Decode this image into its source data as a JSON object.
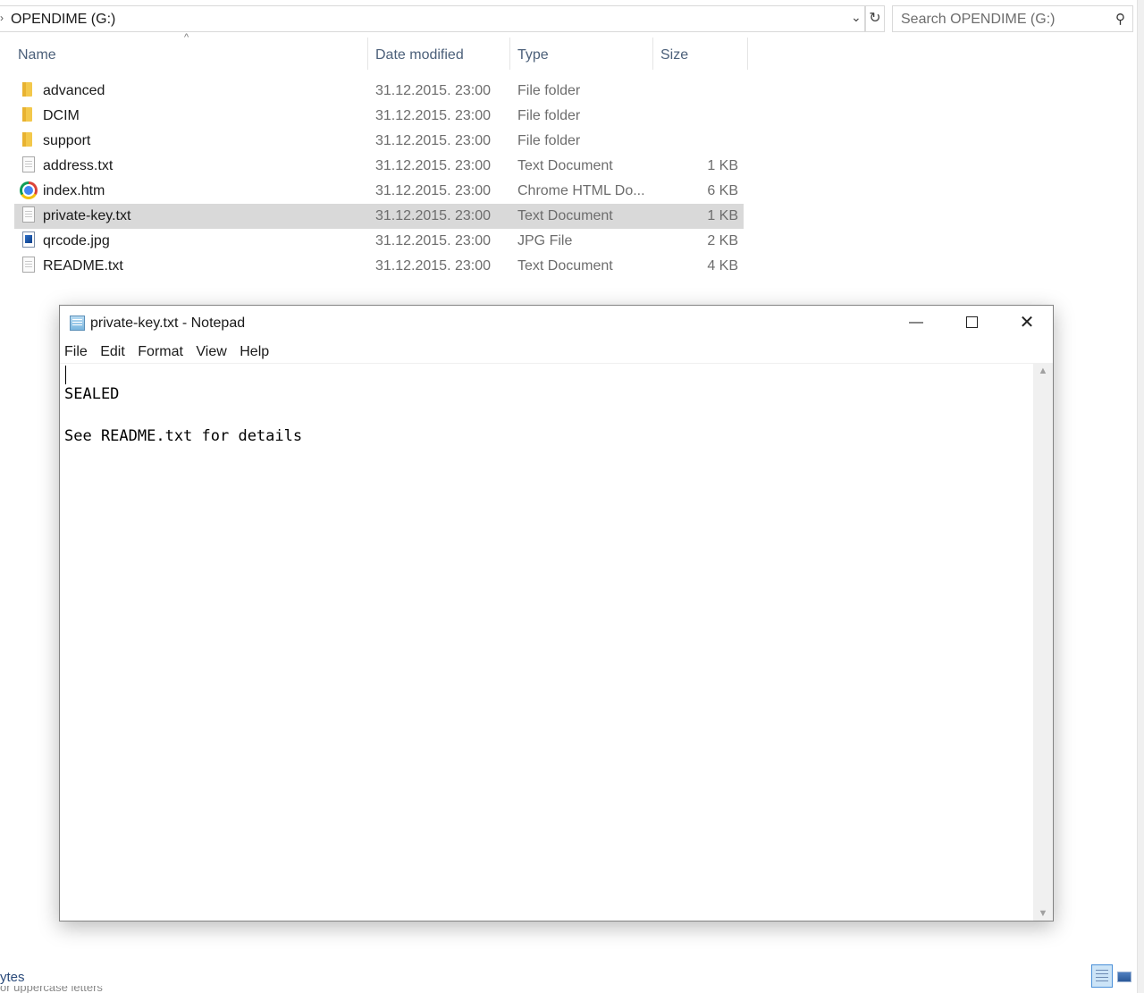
{
  "explorer": {
    "address": "OPENDIME (G:)",
    "search_placeholder": "Search OPENDIME (G:)",
    "columns": {
      "name": "Name",
      "date": "Date modified",
      "type": "Type",
      "size": "Size"
    },
    "files": [
      {
        "name": "advanced",
        "date": "31.12.2015. 23:00",
        "type": "File folder",
        "size": "",
        "icon": "folder-icon"
      },
      {
        "name": "DCIM",
        "date": "31.12.2015. 23:00",
        "type": "File folder",
        "size": "",
        "icon": "folder-icon"
      },
      {
        "name": "support",
        "date": "31.12.2015. 23:00",
        "type": "File folder",
        "size": "",
        "icon": "folder-icon"
      },
      {
        "name": "address.txt",
        "date": "31.12.2015. 23:00",
        "type": "Text Document",
        "size": "1 KB",
        "icon": "text-file-icon"
      },
      {
        "name": "index.htm",
        "date": "31.12.2015. 23:00",
        "type": "Chrome HTML Do...",
        "size": "6 KB",
        "icon": "chrome-icon"
      },
      {
        "name": "private-key.txt",
        "date": "31.12.2015. 23:00",
        "type": "Text Document",
        "size": "1 KB",
        "icon": "text-file-icon",
        "selected": true
      },
      {
        "name": "qrcode.jpg",
        "date": "31.12.2015. 23:00",
        "type": "JPG File",
        "size": "2 KB",
        "icon": "image-file-icon"
      },
      {
        "name": "README.txt",
        "date": "31.12.2015. 23:00",
        "type": "Text Document",
        "size": "4 KB",
        "icon": "text-file-icon"
      }
    ],
    "status": {
      "text": "ytes",
      "cut_text": "or uppercase letters"
    }
  },
  "notepad": {
    "title": "private-key.txt - Notepad",
    "menu": [
      "File",
      "Edit",
      "Format",
      "View",
      "Help"
    ],
    "lines": [
      "SEALED",
      "See README.txt for details"
    ]
  }
}
